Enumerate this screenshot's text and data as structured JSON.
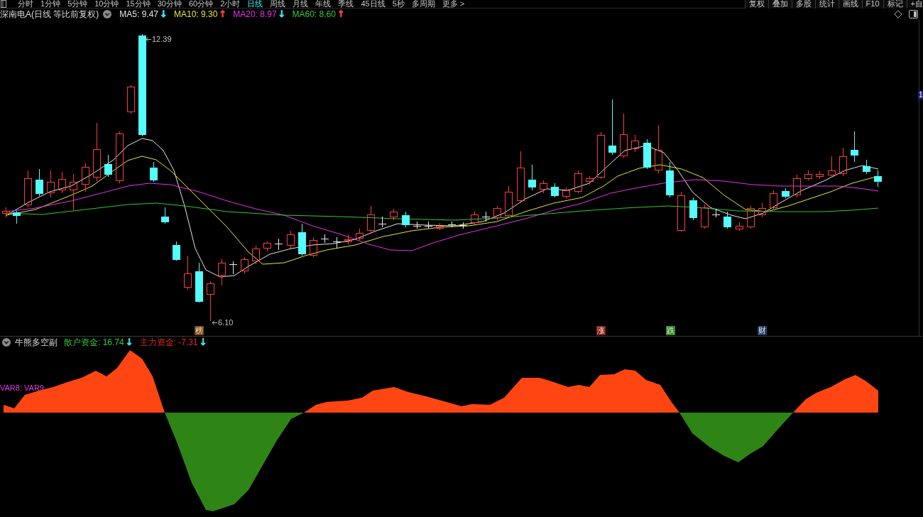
{
  "toolbar": {
    "periods": [
      {
        "label": "分时",
        "selected": false
      },
      {
        "label": "1分钟",
        "selected": false
      },
      {
        "label": "5分钟",
        "selected": false
      },
      {
        "label": "10分钟",
        "selected": false
      },
      {
        "label": "15分钟",
        "selected": false
      },
      {
        "label": "30分钟",
        "selected": false
      },
      {
        "label": "60分钟",
        "selected": false
      },
      {
        "label": "2小时",
        "selected": false
      },
      {
        "label": "日线",
        "selected": true
      },
      {
        "label": "周线",
        "selected": false
      },
      {
        "label": "月线",
        "selected": false
      },
      {
        "label": "年线",
        "selected": false
      },
      {
        "label": "季线",
        "selected": false
      },
      {
        "label": "45日线",
        "selected": false
      },
      {
        "label": "5秒",
        "selected": false
      },
      {
        "label": "多周期",
        "selected": false
      },
      {
        "label": "更多 >",
        "selected": false
      }
    ],
    "tools": [
      {
        "label": "复权"
      },
      {
        "label": "叠加"
      },
      {
        "label": "多股"
      },
      {
        "label": "统计"
      },
      {
        "label": "画线"
      },
      {
        "label": "F10"
      },
      {
        "label": "标记"
      },
      {
        "label": "+自"
      }
    ]
  },
  "chart_header": {
    "title": "深南电A(日线 等比前复权)",
    "indicators": [
      {
        "label": "MA5: 9.47",
        "color": "#e6e6e6",
        "arrow": {
          "text": "↓",
          "color": "#40e8f0"
        }
      },
      {
        "label": "MA10: 9.30",
        "color": "#e6e632",
        "arrow": {
          "text": "↑",
          "color": "#ff3b3b"
        }
      },
      {
        "label": "MA20: 8.97",
        "color": "#e632e6",
        "arrow": {
          "text": "↓",
          "color": "#40e8f0"
        }
      },
      {
        "label": "MA60: 8.60",
        "color": "#32c832",
        "arrow": {
          "text": "↑",
          "color": "#ff3b3b"
        }
      }
    ]
  },
  "price_chart": {
    "high_label": "12.39",
    "low_label": "6.10",
    "price_tag": "1",
    "event_markers": [
      {
        "label": "榜",
        "color": "#7a4a12"
      },
      {
        "label": "涨",
        "color": "#8c1c1c"
      },
      {
        "label": "跌",
        "color": "#2e8b2e"
      },
      {
        "label": "财",
        "color": "#1e3f6e"
      }
    ]
  },
  "indicator_panel": {
    "title": "牛熊多空副",
    "values": [
      {
        "label": "散户资金: 16.74",
        "color": "#32c832",
        "arrow": {
          "text": "↓",
          "color": "#40e8f0"
        }
      },
      {
        "label": "主力资金: -7.31",
        "color": "#e02828",
        "arrow": {
          "text": "↓",
          "color": "#40e8f0"
        }
      }
    ],
    "series_label": "VAR8: VAR9"
  }
}
